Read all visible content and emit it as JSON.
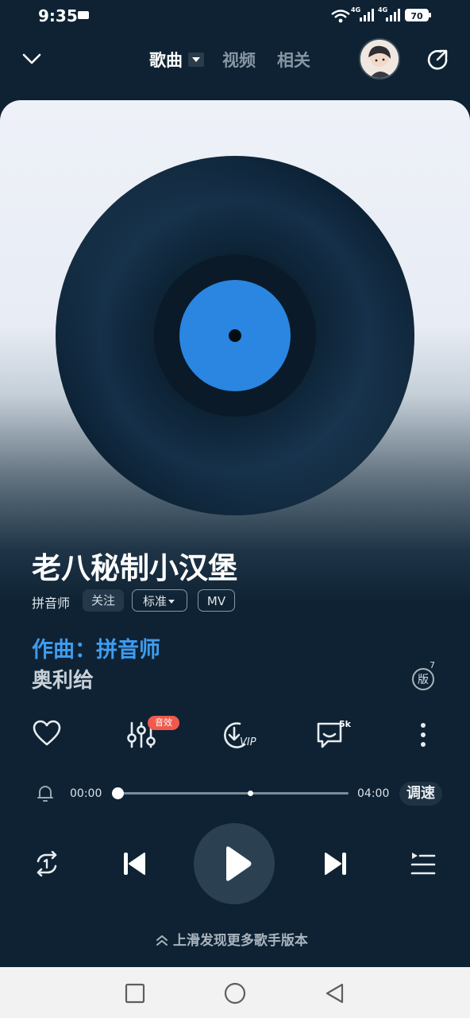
{
  "status_bar": {
    "time": "9:35",
    "signal_1": "4G",
    "signal_2": "4G",
    "battery": "70"
  },
  "header": {
    "tabs": [
      {
        "label": "歌曲",
        "active": true
      },
      {
        "label": "视频",
        "active": false
      },
      {
        "label": "相关",
        "active": false
      }
    ]
  },
  "song": {
    "title": "老八秘制小汉堡",
    "singer": "拼音师",
    "follow_label": "关注",
    "quality_label": "标准",
    "mv_label": "MV",
    "composer_line": "作曲：拼音师",
    "lyric_line": "奥利给",
    "version_label": "版",
    "version_count": "7"
  },
  "actions": {
    "effect_badge": "音效",
    "download_tag": "VIP",
    "comment_count": "5k"
  },
  "progress": {
    "current": "00:00",
    "total": "04:00",
    "fraction": 0.0,
    "speed_label": "调速"
  },
  "hint": {
    "label": "上滑发现更多歌手版本"
  },
  "colors": {
    "background": "#0e2233",
    "accent_blue": "#3d9cf0",
    "badge_red": "#ef5a4c",
    "disc_label": "#2a86e0"
  }
}
